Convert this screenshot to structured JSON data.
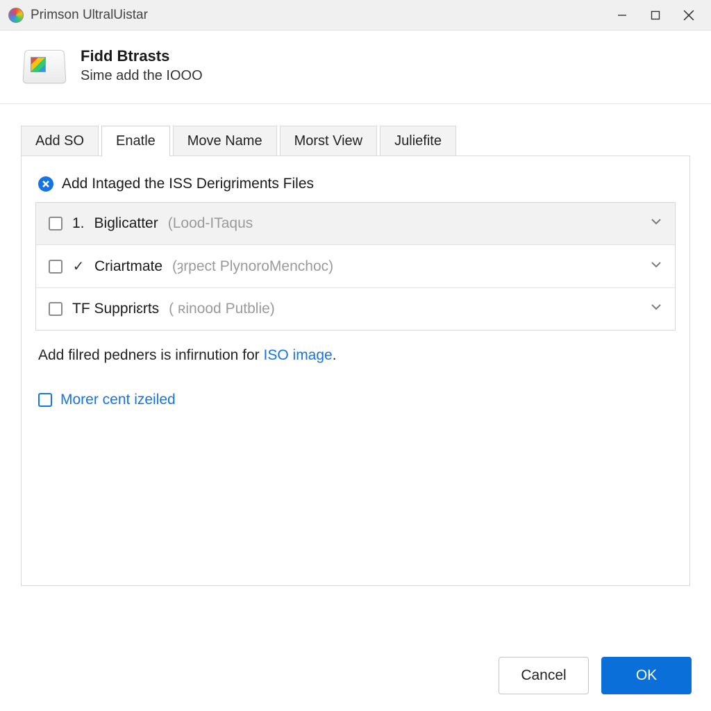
{
  "window": {
    "title": "Primson UltralUistar"
  },
  "header": {
    "title": "Fidd Btrasts",
    "subtitle": "Sime add the IOOO"
  },
  "tabs": [
    {
      "label": "Add SO",
      "active": false
    },
    {
      "label": "Enatle",
      "active": true
    },
    {
      "label": "Move Name",
      "active": false
    },
    {
      "label": "Morst View",
      "active": false
    },
    {
      "label": "Juliefite",
      "active": false
    }
  ],
  "section_title": "Add Intaged the ISS Derigriments Files",
  "items": [
    {
      "prefix": "1.",
      "label": "Biglicatter",
      "paren": "(Lood-ITaqus",
      "checked": false,
      "tick": false,
      "selected": true
    },
    {
      "prefix": "",
      "label": "Criartmate",
      "paren": "(ȝrpect PlynoroMenchoc)",
      "checked": false,
      "tick": true,
      "selected": false
    },
    {
      "prefix": "",
      "label": "TF Suppriɛrts",
      "paren": "( ʀinood Putblie)",
      "checked": false,
      "tick": false,
      "selected": false
    }
  ],
  "helper_prefix": "Add filred pedners is infirnution for ",
  "helper_link": "ISO image",
  "helper_suffix": ".",
  "more_checkbox_label": "Morer cent izeiled",
  "buttons": {
    "cancel": "Cancel",
    "ok": "OK"
  }
}
